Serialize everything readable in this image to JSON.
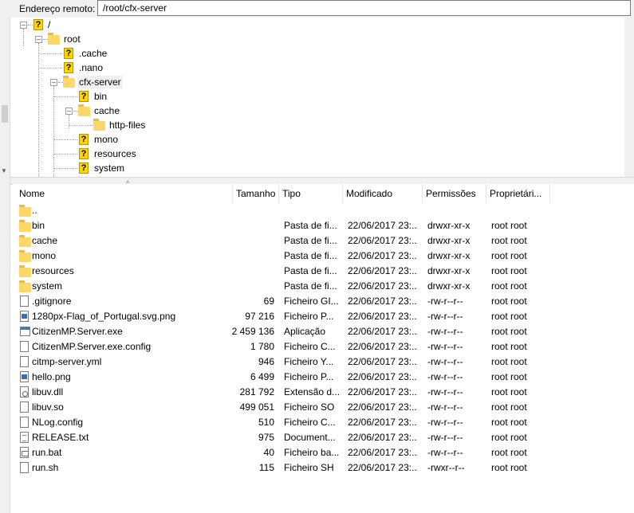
{
  "address": {
    "label": "Endereço remoto:",
    "value": "/root/cfx-server"
  },
  "tree": {
    "nodes": [
      {
        "label": "/",
        "icon": "question-icon"
      },
      {
        "label": "root",
        "icon": "folder-icon"
      },
      {
        "label": ".cache",
        "icon": "question-icon"
      },
      {
        "label": ".nano",
        "icon": "question-icon"
      },
      {
        "label": "cfx-server",
        "icon": "folder-icon"
      },
      {
        "label": "bin",
        "icon": "question-icon"
      },
      {
        "label": "cache",
        "icon": "folder-icon"
      },
      {
        "label": "http-files",
        "icon": "folder-icon"
      },
      {
        "label": "mono",
        "icon": "question-icon"
      },
      {
        "label": "resources",
        "icon": "question-icon"
      },
      {
        "label": "system",
        "icon": "question-icon"
      }
    ]
  },
  "list": {
    "columns": {
      "name": "Nome",
      "size": "Tamanho",
      "type": "Tipo",
      "modified": "Modificado",
      "permissions": "Permissões",
      "owner": "Proprietári..."
    },
    "rows": [
      {
        "name": "..",
        "size": "",
        "type": "",
        "modified": "",
        "perm": "",
        "owner": "",
        "icon": "folder-icon"
      },
      {
        "name": "bin",
        "size": "",
        "type": "Pasta de fi...",
        "modified": "22/06/2017 23:...",
        "perm": "drwxr-xr-x",
        "owner": "root root",
        "icon": "folder-icon"
      },
      {
        "name": "cache",
        "size": "",
        "type": "Pasta de fi...",
        "modified": "22/06/2017 23:...",
        "perm": "drwxr-xr-x",
        "owner": "root root",
        "icon": "folder-icon"
      },
      {
        "name": "mono",
        "size": "",
        "type": "Pasta de fi...",
        "modified": "22/06/2017 23:...",
        "perm": "drwxr-xr-x",
        "owner": "root root",
        "icon": "folder-icon"
      },
      {
        "name": "resources",
        "size": "",
        "type": "Pasta de fi...",
        "modified": "22/06/2017 23:...",
        "perm": "drwxr-xr-x",
        "owner": "root root",
        "icon": "folder-icon"
      },
      {
        "name": "system",
        "size": "",
        "type": "Pasta de fi...",
        "modified": "22/06/2017 23:...",
        "perm": "drwxr-xr-x",
        "owner": "root root",
        "icon": "folder-icon"
      },
      {
        "name": ".gitignore",
        "size": "69",
        "type": "Ficheiro GI...",
        "modified": "22/06/2017 23:...",
        "perm": "-rw-r--r--",
        "owner": "root root",
        "icon": "file-icon"
      },
      {
        "name": "1280px-Flag_of_Portugal.svg.png",
        "size": "97 216",
        "type": "Ficheiro P...",
        "modified": "22/06/2017 23:...",
        "perm": "-rw-r--r--",
        "owner": "root root",
        "icon": "image-file-icon"
      },
      {
        "name": "CitizenMP.Server.exe",
        "size": "2 459 136",
        "type": "Aplicação",
        "modified": "22/06/2017 23:...",
        "perm": "-rw-r--r--",
        "owner": "root root",
        "icon": "application-icon"
      },
      {
        "name": "CitizenMP.Server.exe.config",
        "size": "1 780",
        "type": "Ficheiro C...",
        "modified": "22/06/2017 23:...",
        "perm": "-rw-r--r--",
        "owner": "root root",
        "icon": "file-icon"
      },
      {
        "name": "citmp-server.yml",
        "size": "946",
        "type": "Ficheiro Y...",
        "modified": "22/06/2017 23:...",
        "perm": "-rw-r--r--",
        "owner": "root root",
        "icon": "file-icon"
      },
      {
        "name": "hello.png",
        "size": "6 499",
        "type": "Ficheiro P...",
        "modified": "22/06/2017 23:...",
        "perm": "-rw-r--r--",
        "owner": "root root",
        "icon": "image-file-icon"
      },
      {
        "name": "libuv.dll",
        "size": "281 792",
        "type": "Extensão d...",
        "modified": "22/06/2017 23:...",
        "perm": "-rw-r--r--",
        "owner": "root root",
        "icon": "dll-file-icon"
      },
      {
        "name": "libuv.so",
        "size": "499 051",
        "type": "Ficheiro SO",
        "modified": "22/06/2017 23:...",
        "perm": "-rw-r--r--",
        "owner": "root root",
        "icon": "file-icon"
      },
      {
        "name": "NLog.config",
        "size": "510",
        "type": "Ficheiro C...",
        "modified": "22/06/2017 23:...",
        "perm": "-rw-r--r--",
        "owner": "root root",
        "icon": "file-icon"
      },
      {
        "name": "RELEASE.txt",
        "size": "975",
        "type": "Document...",
        "modified": "22/06/2017 23:...",
        "perm": "-rw-r--r--",
        "owner": "root root",
        "icon": "text-file-icon"
      },
      {
        "name": "run.bat",
        "size": "40",
        "type": "Ficheiro ba...",
        "modified": "22/06/2017 23:...",
        "perm": "-rw-r--r--",
        "owner": "root root",
        "icon": "batch-file-icon"
      },
      {
        "name": "run.sh",
        "size": "115",
        "type": "Ficheiro SH",
        "modified": "22/06/2017 23:...",
        "perm": "-rwxr--r--",
        "owner": "root root",
        "icon": "file-icon"
      }
    ]
  }
}
